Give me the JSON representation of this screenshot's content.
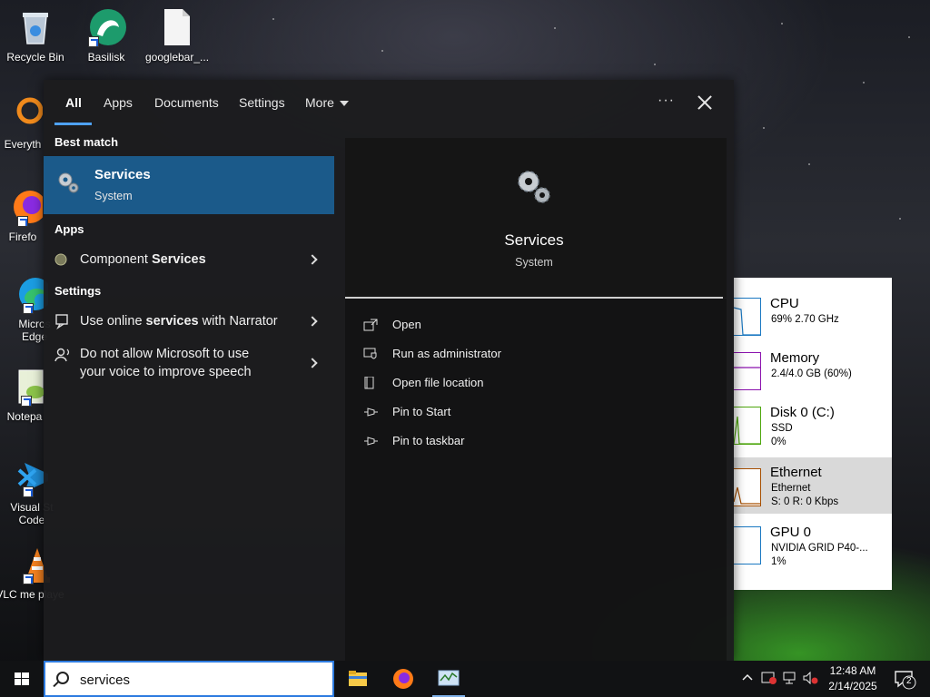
{
  "desktop": {
    "icons": [
      {
        "label": "Recycle Bin"
      },
      {
        "label": "Basilisk"
      },
      {
        "label": "googlebar_..."
      },
      {
        "label": "Everyth"
      },
      {
        "label": "Firefo"
      },
      {
        "label": "Micros Edge"
      },
      {
        "label": "Notepa"
      },
      {
        "label": "Visual St Code"
      },
      {
        "label": "VLC me playe"
      }
    ]
  },
  "task_manager": {
    "items": [
      {
        "name": "CPU",
        "line1": "69%  2.70 GHz",
        "line2": "",
        "color": "#1a78c2"
      },
      {
        "name": "Memory",
        "line1": "2.4/4.0 GB (60%)",
        "line2": "",
        "color": "#8b12ae"
      },
      {
        "name": "Disk 0 (C:)",
        "line1": "SSD",
        "line2": "0%",
        "color": "#4da60c"
      },
      {
        "name": "Ethernet",
        "line1": "Ethernet",
        "line2": "S: 0  R: 0 Kbps",
        "color": "#a74f01"
      },
      {
        "name": "GPU 0",
        "line1": "NVIDIA GRID P40-...",
        "line2": "1%",
        "color": "#1a78c2"
      }
    ]
  },
  "search_panel": {
    "tabs": [
      {
        "label": "All",
        "active": true
      },
      {
        "label": "Apps"
      },
      {
        "label": "Documents"
      },
      {
        "label": "Settings"
      },
      {
        "label": "More"
      }
    ],
    "options_label": "···",
    "sections": {
      "best_match": "Best match",
      "apps": "Apps",
      "settings": "Settings"
    },
    "best_match": {
      "name": "Services",
      "subtitle": "System"
    },
    "apps": [
      {
        "pre": "Component ",
        "bold": "Services"
      }
    ],
    "settings": [
      {
        "pre": "Use online ",
        "bold": "services",
        "post": " with Narrator"
      },
      {
        "line1": "Do not allow Microsoft to use",
        "line2": "your voice to improve speech"
      }
    ],
    "detail": {
      "name": "Services",
      "subtitle": "System",
      "actions": [
        "Open",
        "Run as administrator",
        "Open file location",
        "Pin to Start",
        "Pin to taskbar"
      ]
    }
  },
  "taskbar": {
    "search_value": "services",
    "clock_time": "12:48 AM",
    "clock_date": "2/14/2025",
    "notification_count": "2"
  },
  "colors": {
    "accent": "#1b5a8a",
    "tab_underline": "#4ea1f3"
  }
}
